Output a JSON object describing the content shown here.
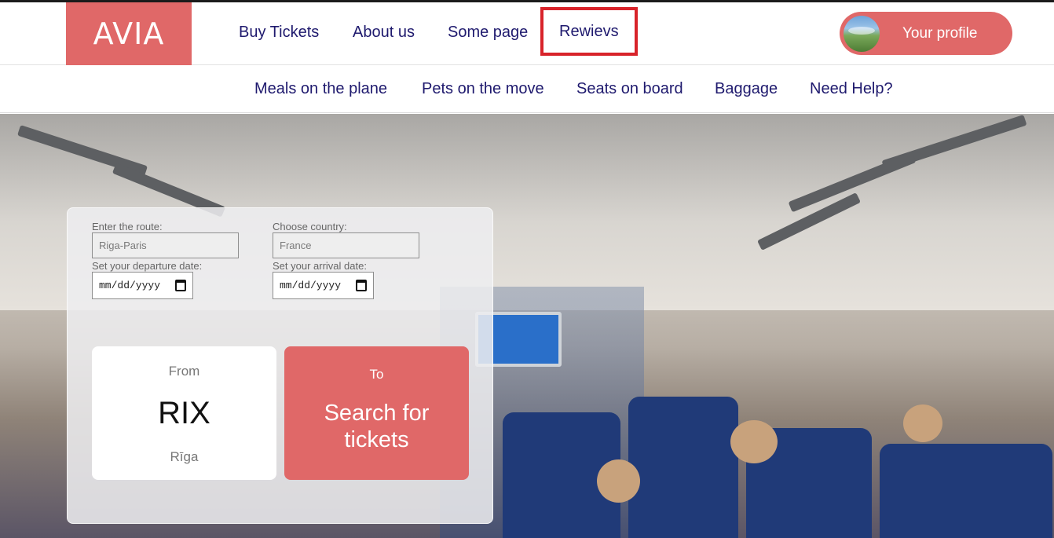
{
  "header": {
    "logo": "AVIA",
    "nav": [
      {
        "label": "Buy Tickets"
      },
      {
        "label": "About us"
      },
      {
        "label": "Some page"
      },
      {
        "label": "Rewievs"
      }
    ],
    "profile_label": "Your profile"
  },
  "subnav": [
    {
      "label": "Meals on the plane"
    },
    {
      "label": "Pets on the move"
    },
    {
      "label": "Seats on board"
    },
    {
      "label": "Baggage"
    },
    {
      "label": "Need Help?"
    }
  ],
  "form": {
    "route_label": "Enter the route:",
    "route_value": "Riga-Paris",
    "country_label": "Choose country:",
    "country_value": "France",
    "departure_label": "Set your departure date:",
    "departure_value": "mm/dd/yyyy",
    "arrival_label": "Set your arrival date:",
    "arrival_value": "mm/dd/yyyy"
  },
  "from_card": {
    "label": "From",
    "code": "RIX",
    "city": "Rīga"
  },
  "search_card": {
    "to_label": "To",
    "button_label": "Search for tickets"
  },
  "colors": {
    "accent": "#e06868",
    "nav_text": "#1f1a6e",
    "highlight": "#d8232a"
  }
}
